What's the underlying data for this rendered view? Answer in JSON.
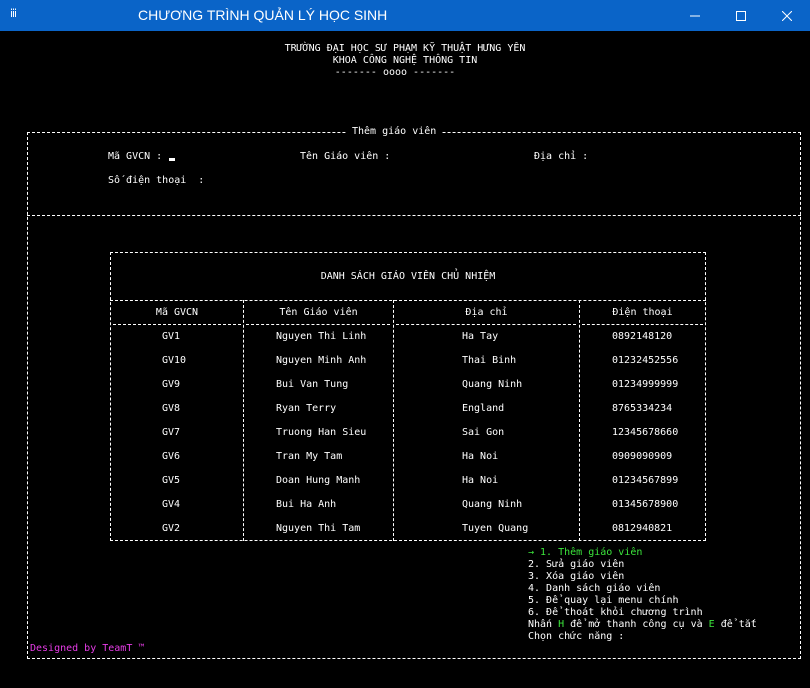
{
  "window": {
    "title": "CHƯƠNG TRÌNH QUẢN LÝ HỌC SINH",
    "icon": "console-icon"
  },
  "header": {
    "line1": "TRƯỜNG ĐẠI HỌC SƯ PHẠM KỸ THUẬT HƯNG YÊN",
    "line2": "KHOA CÔNG NGHỆ THÔNG TIN",
    "line3": "------- oooo -------"
  },
  "form": {
    "legend": "Thêm giáo viên",
    "field_ma": "Mã GVCN :",
    "field_ten": "Tên Giáo viên :",
    "field_diachi": "Địa chỉ :",
    "field_sdt": "Số điện thoại  :"
  },
  "table": {
    "title": "DANH SÁCH GIÁO VIÊN CHỦ NHIỆM",
    "columns": [
      "Mã GVCN",
      "Tên Giáo viên",
      "Địa chỉ",
      "Điện thoại"
    ],
    "rows": [
      {
        "ma": "GV1",
        "ten": "Nguyen Thi Linh",
        "diachi": "Ha Tay",
        "dienthoai": "0892148120"
      },
      {
        "ma": "GV10",
        "ten": "Nguyen Minh Anh",
        "diachi": "Thai Binh",
        "dienthoai": "01232452556"
      },
      {
        "ma": "GV9",
        "ten": "Bui Van Tung",
        "diachi": "Quang Ninh",
        "dienthoai": "01234999999"
      },
      {
        "ma": "GV8",
        "ten": "Ryan Terry",
        "diachi": "England",
        "dienthoai": "8765334234"
      },
      {
        "ma": "GV7",
        "ten": "Truong Han Sieu",
        "diachi": "Sai Gon",
        "dienthoai": "12345678660"
      },
      {
        "ma": "GV6",
        "ten": "Tran My Tam",
        "diachi": "Ha Noi",
        "dienthoai": "0909090909"
      },
      {
        "ma": "GV5",
        "ten": "Doan Hung Manh",
        "diachi": "Ha Noi",
        "dienthoai": "01234567899"
      },
      {
        "ma": "GV4",
        "ten": "Bui Ha Anh",
        "diachi": "Quang Ninh",
        "dienthoai": "01345678900"
      },
      {
        "ma": "GV2",
        "ten": "Nguyen Thi Tam",
        "diachi": "Tuyen Quang",
        "dienthoai": "0812940821"
      }
    ]
  },
  "menu": {
    "item1": "→ 1. Thêm giáo viên",
    "item2": "2. Sửa giáo viên",
    "item3": "3. Xóa giáo viên",
    "item4": "4. Danh sách giáo viên",
    "item5": "5. Để quay lại menu chính",
    "item6": "6. Để thoát khỏi chương trình",
    "hint_a": "Nhấn ",
    "hint_h": "H",
    "hint_b": " để mở thanh công cụ và ",
    "hint_e": "E",
    "hint_c": " để tắt",
    "prompt": "Chọn chức năng :"
  },
  "footer": {
    "designed": "Designed by TeamT ™"
  },
  "colors": {
    "titlebar": "#0a64c8",
    "background": "#000000",
    "text": "#ffffff",
    "selected": "#3ce63c",
    "footer": "#e63ce6"
  }
}
